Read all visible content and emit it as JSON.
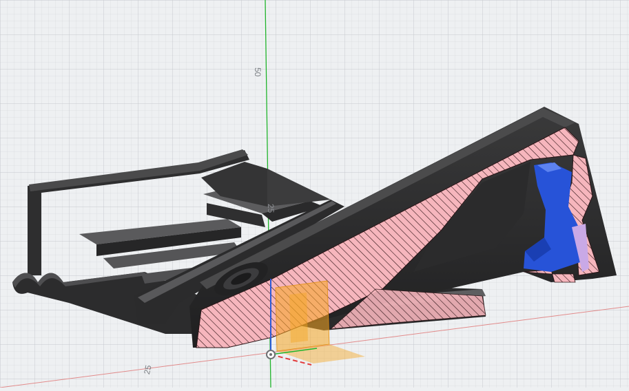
{
  "viewport": {
    "grid_labels": {
      "major_vertical": "50",
      "minor_vertical": "25",
      "horizontal": "25"
    },
    "colors": {
      "background": "#eef0f2",
      "grid_minor": "#d7dadd",
      "grid_major": "#c3c7cb",
      "axis_y": "#1fb32a",
      "axis_x": "#e23b3b",
      "axis_z": "#2b5bdb",
      "part_body": "#2b2b2c",
      "part_shade": "#3d3d3e",
      "section_fill": "#f6b6bd",
      "section_hatch": "#2a1416",
      "insert_blue": "#2753d8",
      "origin_plane": "#f5a623"
    },
    "icons": {
      "origin": "origin-point-icon"
    }
  }
}
